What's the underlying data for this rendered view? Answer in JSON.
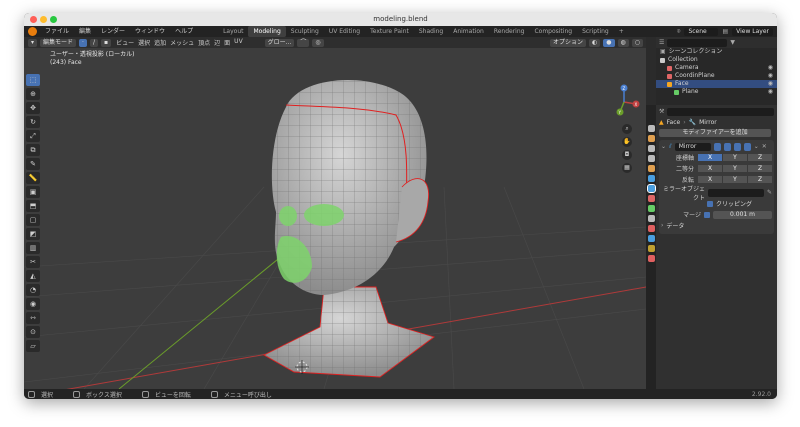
{
  "window": {
    "title": "modeling.blend",
    "traffic_lights": [
      "#ff5f57",
      "#febc2e",
      "#28c840"
    ]
  },
  "topbar": {
    "menus": [
      "ファイル",
      "編集",
      "レンダー",
      "ウィンドウ",
      "ヘルプ"
    ],
    "workspaces": [
      "Layout",
      "Modeling",
      "Sculpting",
      "UV Editing",
      "Texture Paint",
      "Shading",
      "Animation",
      "Rendering",
      "Compositing",
      "Scripting"
    ],
    "active_workspace": "Modeling",
    "add_workspace": "+",
    "scene": "Scene",
    "view_layer": "View Layer"
  },
  "viewport": {
    "header": {
      "mode": "編集モード",
      "menus": [
        "ビュー",
        "選択",
        "追加",
        "メッシュ",
        "頂点",
        "辺",
        "面",
        "UV"
      ],
      "orientation": "グロー...",
      "options": "オプション"
    },
    "info_line1": "ユーザー・透視投影 (ローカル)",
    "info_line2": "(243) Face",
    "gizmo_axes": {
      "x": "X",
      "y": "Y",
      "z": "Z"
    },
    "colors": {
      "background": "#3d3d3d",
      "mesh": "#b8b8b8",
      "seam": "#e02020",
      "selected_face": "#7ed36b",
      "x_axis": "#b03a3a",
      "y_axis": "#6b9e2a"
    }
  },
  "tools": [
    "select-box",
    "cursor",
    "move",
    "rotate",
    "scale",
    "transform",
    "annotate",
    "measure",
    "add-cube",
    "extrude",
    "inset",
    "bevel",
    "loop-cut",
    "knife",
    "poly-build",
    "spin",
    "smooth",
    "edge-slide",
    "shrink",
    "shear",
    "rip"
  ],
  "outliner": {
    "title": "シーンコレクション",
    "items": [
      {
        "label": "Collection",
        "indent": 0,
        "color": "#cccccc"
      },
      {
        "label": "Camera",
        "indent": 1,
        "color": "#e06666"
      },
      {
        "label": "CoordinPlane",
        "indent": 1,
        "color": "#e06666"
      },
      {
        "label": "Face",
        "indent": 1,
        "color": "#f5a623",
        "selected": true
      },
      {
        "label": "Plane",
        "indent": 2,
        "color": "#66cc66"
      }
    ]
  },
  "properties": {
    "object_name": "Face",
    "modifier_breadcrumb": "Mirror",
    "add_modifier": "モディファイアーを追加",
    "modifier_name": "Mirror",
    "rows": [
      {
        "label": "座標軸",
        "axes": [
          "X",
          "Y",
          "Z"
        ],
        "active": 0
      },
      {
        "label": "二等分",
        "axes": [
          "X",
          "Y",
          "Z"
        ],
        "active": -1
      },
      {
        "label": "反転",
        "axes": [
          "X",
          "Y",
          "Z"
        ],
        "active": -1
      }
    ],
    "mirror_object_label": "ミラーオブジェクト",
    "clipping_label": "クリッピング",
    "merge_label": "マージ",
    "merge_value": "0.001 m",
    "data_label": "データ"
  },
  "statusbar": {
    "items": [
      "選択",
      "ボックス選択",
      "ビューを回転",
      "メニュー呼び出し"
    ],
    "version": "2.92.0"
  }
}
